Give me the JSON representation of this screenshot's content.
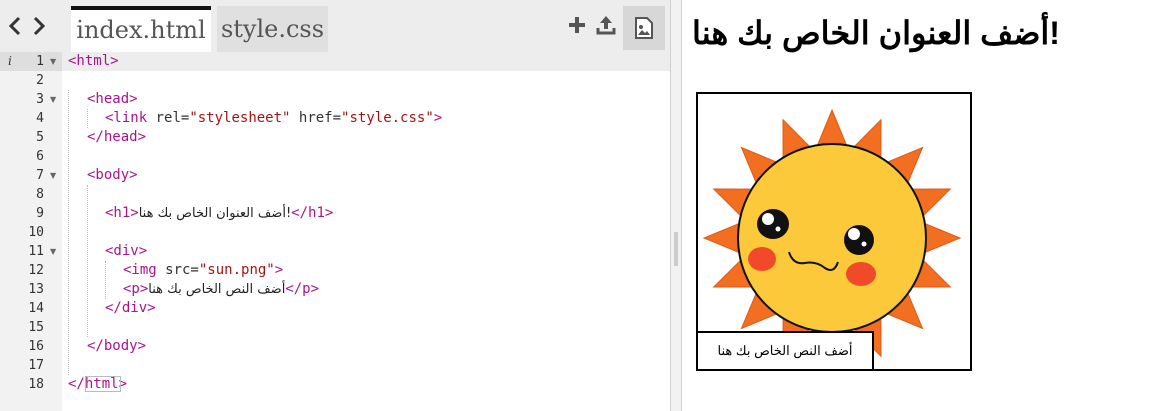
{
  "toolbar": {
    "back_label": "‹",
    "forward_label": "›",
    "add_icon": "plus-icon",
    "upload_icon": "upload-icon",
    "image_icon": "image-icon"
  },
  "tabs": [
    {
      "label": "index.html",
      "active": true
    },
    {
      "label": "style.css",
      "active": false
    }
  ],
  "editor": {
    "line_numbers": [
      "1",
      "2",
      "3",
      "4",
      "5",
      "6",
      "7",
      "8",
      "9",
      "10",
      "11",
      "12",
      "13",
      "14",
      "15",
      "16",
      "17",
      "18"
    ],
    "code": {
      "l1_open": "<html>",
      "l3_head": "<head>",
      "l4_link": "<link",
      "l4_rel_attr": " rel=",
      "l4_rel_val": "\"stylesheet\"",
      "l4_href_attr": " href=",
      "l4_href_val": "\"style.css\"",
      "l4_close": ">",
      "l5_head_close": "</head>",
      "l7_body": "<body>",
      "l9_h1_open": "<h1>",
      "l9_text": "!أضف العنوان الخاص بك هنا",
      "l9_h1_close": "</h1>",
      "l11_div": "<div>",
      "l12_img": "<img",
      "l12_src_attr": " src=",
      "l12_src_val": "\"sun.png\"",
      "l12_close": ">",
      "l13_p_open": "<p>",
      "l13_text": "أضف النص الخاص بك هنا",
      "l13_p_close": "</p>",
      "l14_div_close": "</div>",
      "l16_body_close": "</body>",
      "l18_html_close": "</html>"
    }
  },
  "preview": {
    "heading": "!أضف العنوان الخاص بك هنا",
    "paragraph": "أضف النص الخاص بك هنا",
    "image_name": "sun-image"
  },
  "colors": {
    "tag": "#a8158a",
    "string": "#a31515",
    "sun_rays": "#f26f21",
    "sun_face": "#fcc93a",
    "cheeks": "#f04a2a"
  }
}
